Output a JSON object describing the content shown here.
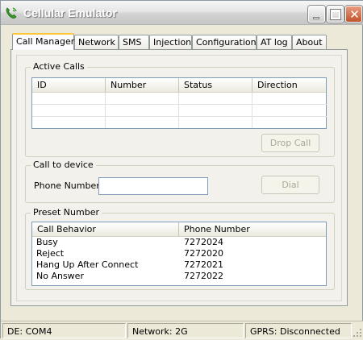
{
  "window": {
    "title": "Cellular Emulator"
  },
  "tabs": [
    "Call Manager",
    "Network",
    "SMS",
    "Injection",
    "Configuration",
    "AT log",
    "About"
  ],
  "active_calls": {
    "label": "Active Calls",
    "columns": [
      "ID",
      "Number",
      "Status",
      "Direction"
    ],
    "drop_button": "Drop Call"
  },
  "call_to_device": {
    "label": "Call to device",
    "phone_label": "Phone Number:",
    "phone_value": "",
    "dial_button": "Dial"
  },
  "preset": {
    "label": "Preset Number",
    "columns": [
      "Call Behavior",
      "Phone Number"
    ],
    "rows": [
      {
        "behavior": "Busy",
        "number": "7272024"
      },
      {
        "behavior": "Reject",
        "number": "7272020"
      },
      {
        "behavior": "Hang Up After Connect",
        "number": "7272021"
      },
      {
        "behavior": "No Answer",
        "number": "7272022"
      }
    ]
  },
  "status": {
    "de": "DE: COM4",
    "network": "Network: 2G",
    "gprs": "GPRS: Disconnected"
  },
  "icons": {
    "app": "phone-icon",
    "minimize": "minimize-icon",
    "maximize": "maximize-icon",
    "close": "close-icon"
  },
  "colors": {
    "tab_highlight": "#ffc83c",
    "close_button": "#c3532c",
    "app_icon": "#3a9a2a"
  }
}
